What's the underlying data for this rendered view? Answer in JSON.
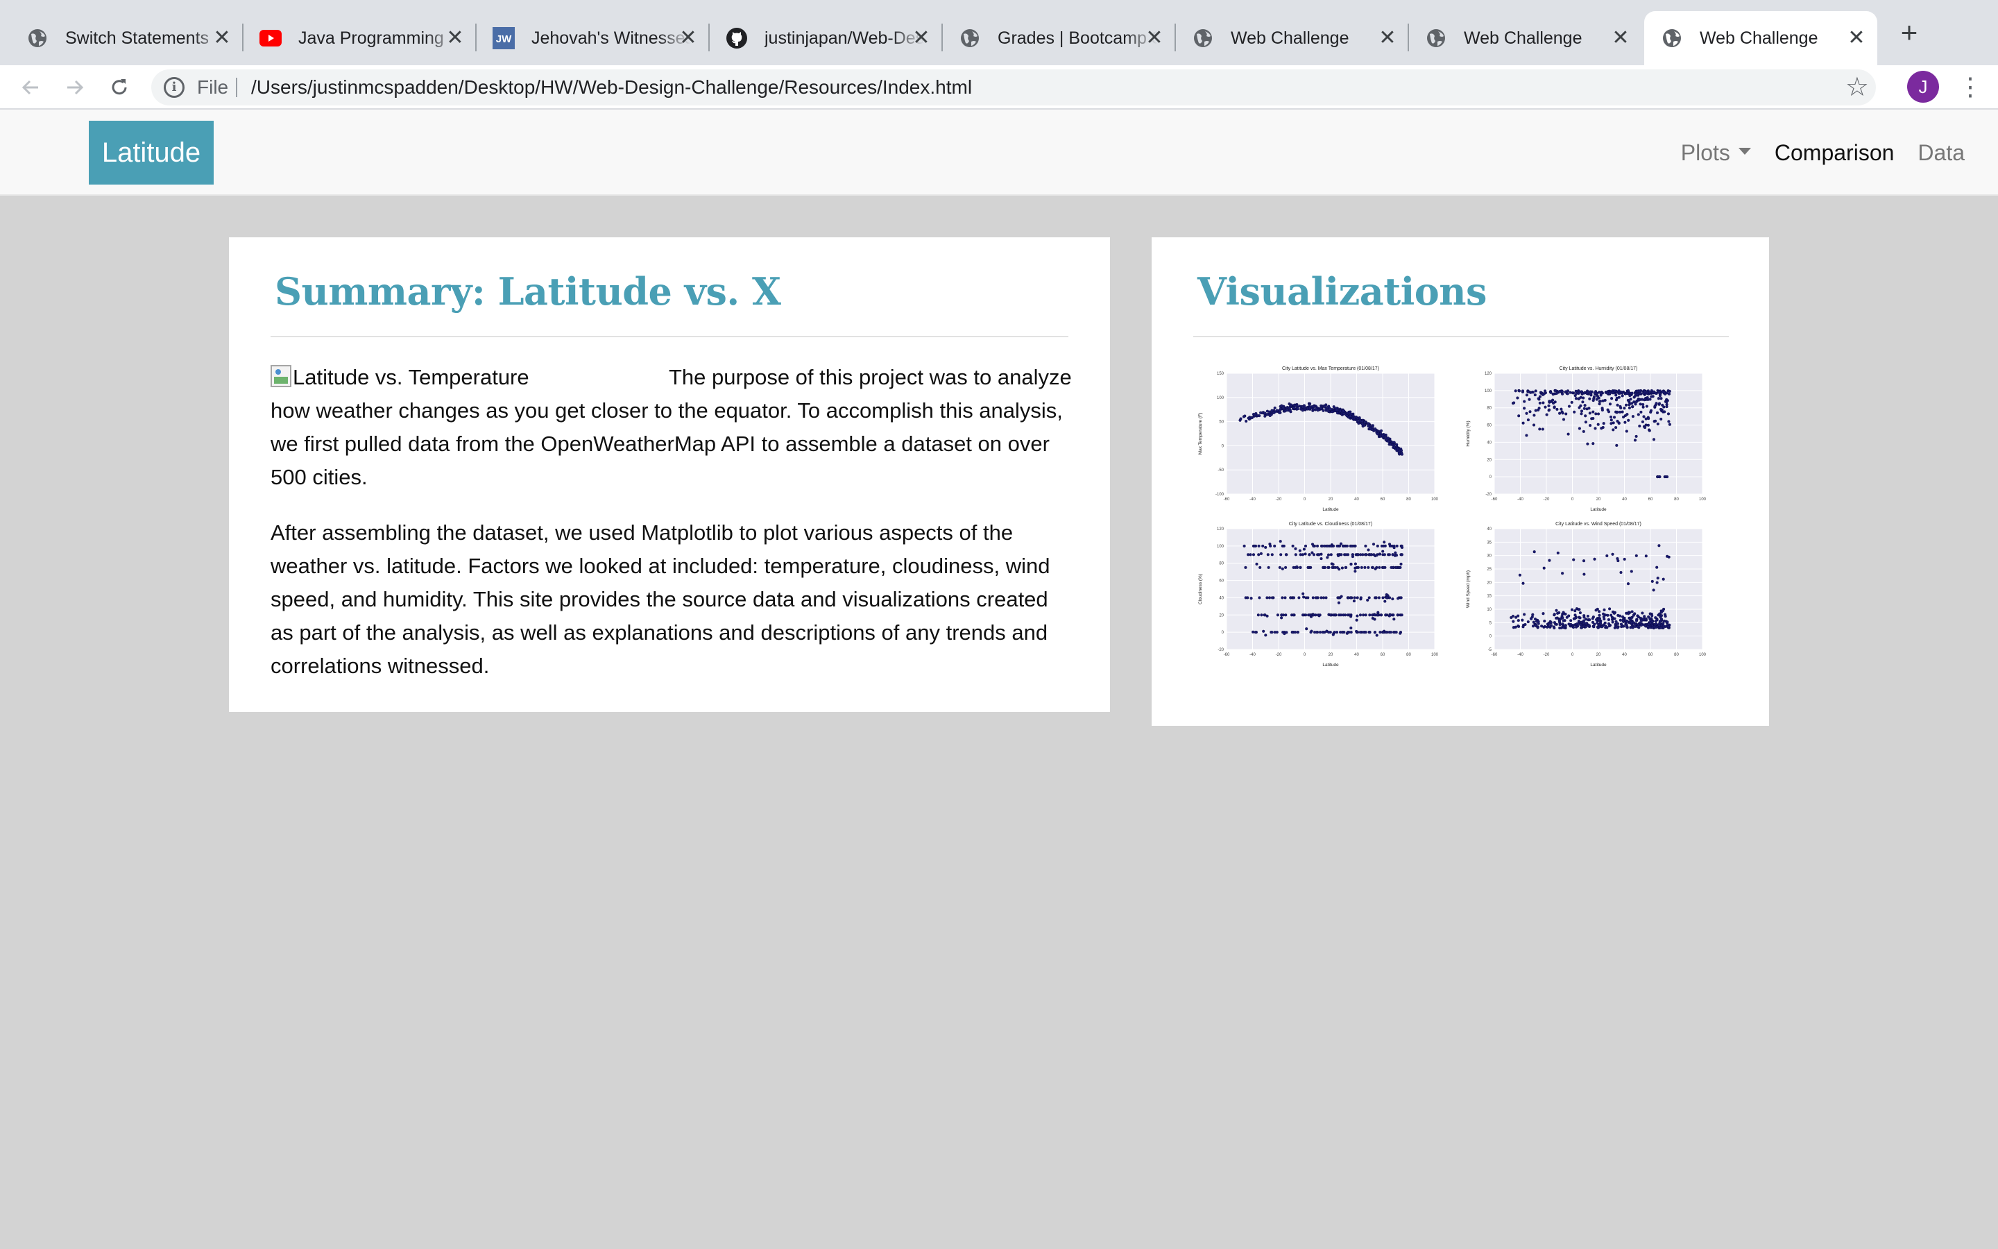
{
  "browser": {
    "tabs": [
      {
        "title": "Switch Statements",
        "icon": "globe-icon",
        "active": false
      },
      {
        "title": "Java Programming",
        "icon": "youtube-icon",
        "active": false
      },
      {
        "title": "Jehovah's Witnesses",
        "icon": "jw-icon",
        "active": false
      },
      {
        "title": "justinjapan/Web-Design-Challenge",
        "icon": "github-icon",
        "active": false
      },
      {
        "title": "Grades | Bootcamp Spot",
        "icon": "globe-icon",
        "active": false
      },
      {
        "title": "Web Challenge",
        "icon": "globe-icon",
        "active": false
      },
      {
        "title": "Web Challenge",
        "icon": "globe-icon",
        "active": false
      },
      {
        "title": "Web Challenge",
        "icon": "globe-icon",
        "active": true
      }
    ],
    "close_glyph": "✕",
    "new_tab_glyph": "+",
    "jw_logo_text": "JW",
    "address": {
      "scheme_label": "File",
      "url": "/Users/justinmcspadden/Desktop/HW/Web-Design-Challenge/Resources/Index.html"
    },
    "profile_initial": "J"
  },
  "site": {
    "brand": "Latitude",
    "nav": {
      "plots": "Plots",
      "comparison": "Comparison",
      "data": "Data"
    },
    "summary": {
      "heading": "Summary: Latitude vs. X",
      "image_alt": "Latitude vs. Temperature",
      "paragraph1": "The purpose of this project was to analyze how weather changes as you get closer to the equator. To accomplish this analysis, we first pulled data from the OpenWeatherMap API to assemble a dataset on over 500 cities.",
      "paragraph2": "After assembling the dataset, we used Matplotlib to plot various aspects of the weather vs. latitude. Factors we looked at included: temperature, cloudiness, wind speed, and humidity. This site provides the source data and visualizations created as part of the analysis, as well as explanations and descriptions of any trends and correlations witnessed."
    },
    "visualizations": {
      "heading": "Visualizations"
    }
  },
  "chart_data": [
    {
      "type": "scatter",
      "title": "City Latitude vs. Max Temperature (01/08/17)",
      "xlabel": "Latitude",
      "ylabel": "Max Temperature (F)",
      "xlim": [
        -60,
        100
      ],
      "ylim": [
        -100,
        150
      ],
      "xticks": [
        -60,
        -40,
        -20,
        0,
        20,
        40,
        60,
        80,
        100
      ],
      "yticks": [
        -100,
        -50,
        0,
        50,
        100,
        150
      ],
      "marker_color": "#1a1a6e",
      "pattern": "temperature"
    },
    {
      "type": "scatter",
      "title": "City Latitude vs. Humidity (01/08/17)",
      "xlabel": "Latitude",
      "ylabel": "Humidity (%)",
      "xlim": [
        -60,
        100
      ],
      "ylim": [
        -20,
        120
      ],
      "xticks": [
        -60,
        -40,
        -20,
        0,
        20,
        40,
        60,
        80,
        100
      ],
      "yticks": [
        -20,
        0,
        20,
        40,
        60,
        80,
        100,
        120
      ],
      "marker_color": "#1a1a6e",
      "pattern": "humidity"
    },
    {
      "type": "scatter",
      "title": "City Latitude vs. Cloudiness (01/08/17)",
      "xlabel": "Latitude",
      "ylabel": "Cloudiness (%)",
      "xlim": [
        -60,
        100
      ],
      "ylim": [
        -20,
        120
      ],
      "xticks": [
        -60,
        -40,
        -20,
        0,
        20,
        40,
        60,
        80,
        100
      ],
      "yticks": [
        -20,
        0,
        20,
        40,
        60,
        80,
        100,
        120
      ],
      "marker_color": "#1a1a6e",
      "pattern": "cloudiness"
    },
    {
      "type": "scatter",
      "title": "City Latitude vs. Wind Speed (01/08/17)",
      "xlabel": "Latitude",
      "ylabel": "Wind Speed (mph)",
      "xlim": [
        -60,
        100
      ],
      "ylim": [
        -5,
        40
      ],
      "xticks": [
        -60,
        -40,
        -20,
        0,
        20,
        40,
        60,
        80,
        100
      ],
      "yticks": [
        -5,
        0,
        5,
        10,
        15,
        20,
        25,
        30,
        35,
        40
      ],
      "marker_color": "#1a1a6e",
      "pattern": "wind"
    }
  ],
  "colors": {
    "accent": "#4a9fb5",
    "page_bg": "#d3d3d3",
    "chart_bg": "#eaeaf2"
  }
}
